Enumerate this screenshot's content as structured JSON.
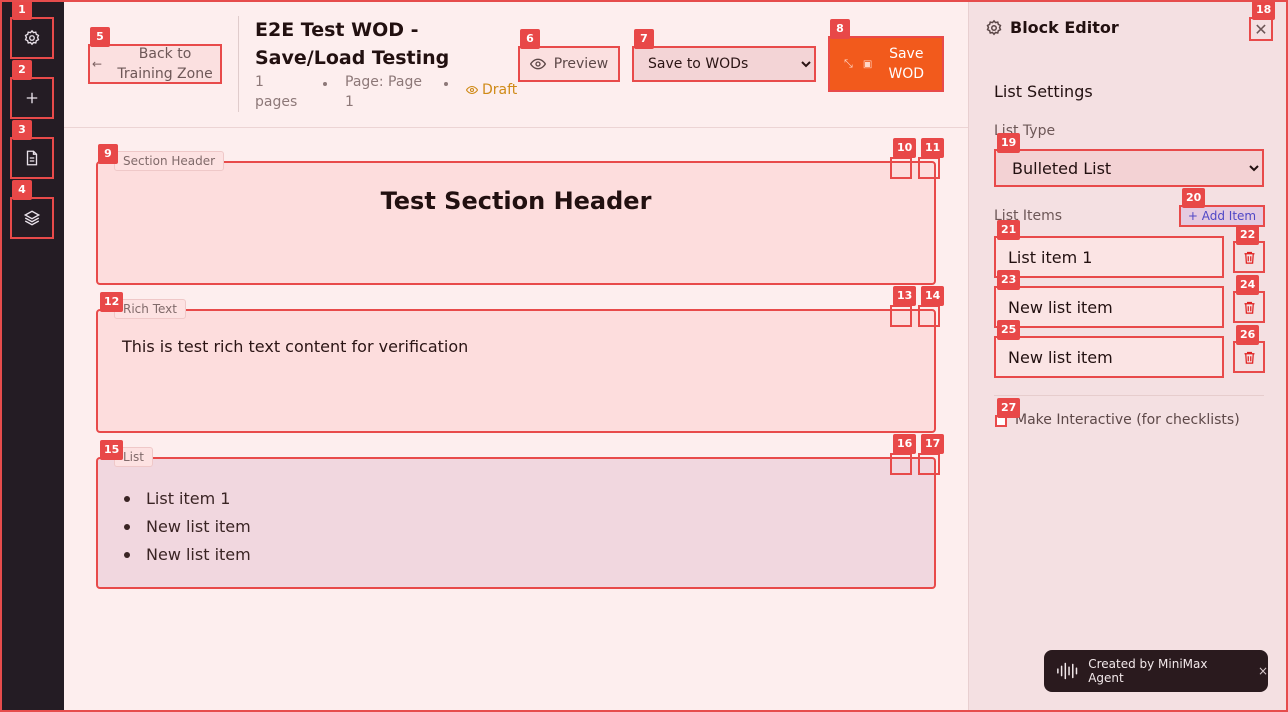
{
  "rail": {
    "items": [
      {
        "icon": "gear-icon",
        "badge": "1"
      },
      {
        "icon": "plus-icon",
        "badge": "2"
      },
      {
        "icon": "document-icon",
        "badge": "3"
      },
      {
        "icon": "layers-icon",
        "badge": "4"
      }
    ]
  },
  "header": {
    "back_label": "Back to Training Zone",
    "title": "E2E Test WOD - Save/Load Testing",
    "pages": "1 pages",
    "page_label": "Page: Page 1",
    "status": "Draft",
    "preview_label": "Preview",
    "save_target": "Save to WODs",
    "save_label": "Save WOD"
  },
  "badges": {
    "b5": "5",
    "b6": "6",
    "b7": "7",
    "b8": "8",
    "b9": "9",
    "b10": "10",
    "b11": "11",
    "b12": "12",
    "b13": "13",
    "b14": "14",
    "b15": "15",
    "b16": "16",
    "b17": "17",
    "b18": "18",
    "b19": "19",
    "b20": "20",
    "b21": "21",
    "b22": "22",
    "b23": "23",
    "b24": "24",
    "b25": "25",
    "b26": "26",
    "b27": "27"
  },
  "blocks": {
    "section_header": {
      "tag": "Section Header",
      "text": "Test Section Header"
    },
    "rich_text": {
      "tag": "Rich Text",
      "text": "This is test rich text content for verification"
    },
    "list": {
      "tag": "List",
      "items": [
        "List item 1",
        "New list item",
        "New list item"
      ]
    }
  },
  "panel": {
    "title": "Block Editor",
    "section": "List Settings",
    "list_type_label": "List Type",
    "list_type_value": "Bulleted List",
    "list_items_label": "List Items",
    "add_item_label": "+ Add Item",
    "items": [
      "List item 1",
      "New list item",
      "New list item"
    ],
    "interactive_label": "Make Interactive (for checklists)"
  },
  "toast": {
    "text": "Created by MiniMax Agent",
    "close": "×"
  },
  "colors": {
    "accent": "#f25a1c",
    "highlight": "#e84a4a",
    "draft": "#cf8a17",
    "rail": "#241c24"
  }
}
